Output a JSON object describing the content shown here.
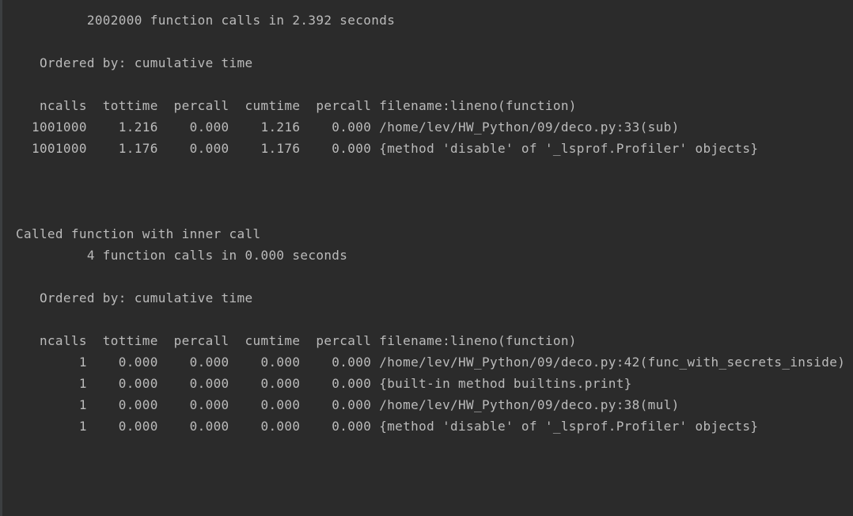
{
  "console": {
    "lines": [
      "         2002000 function calls in 2.392 seconds",
      "",
      "   Ordered by: cumulative time",
      "",
      "   ncalls  tottime  percall  cumtime  percall filename:lineno(function)",
      "  1001000    1.216    0.000    1.216    0.000 /home/lev/HW_Python/09/deco.py:33(sub)",
      "  1001000    1.176    0.000    1.176    0.000 {method 'disable' of '_lsprof.Profiler' objects}",
      "",
      "",
      "",
      "Called function with inner call",
      "         4 function calls in 0.000 seconds",
      "",
      "   Ordered by: cumulative time",
      "",
      "   ncalls  tottime  percall  cumtime  percall filename:lineno(function)",
      "        1    0.000    0.000    0.000    0.000 /home/lev/HW_Python/09/deco.py:42(func_with_secrets_inside)",
      "        1    0.000    0.000    0.000    0.000 {built-in method builtins.print}",
      "        1    0.000    0.000    0.000    0.000 /home/lev/HW_Python/09/deco.py:38(mul)",
      "        1    0.000    0.000    0.000    0.000 {method 'disable' of '_lsprof.Profiler' objects}"
    ]
  }
}
